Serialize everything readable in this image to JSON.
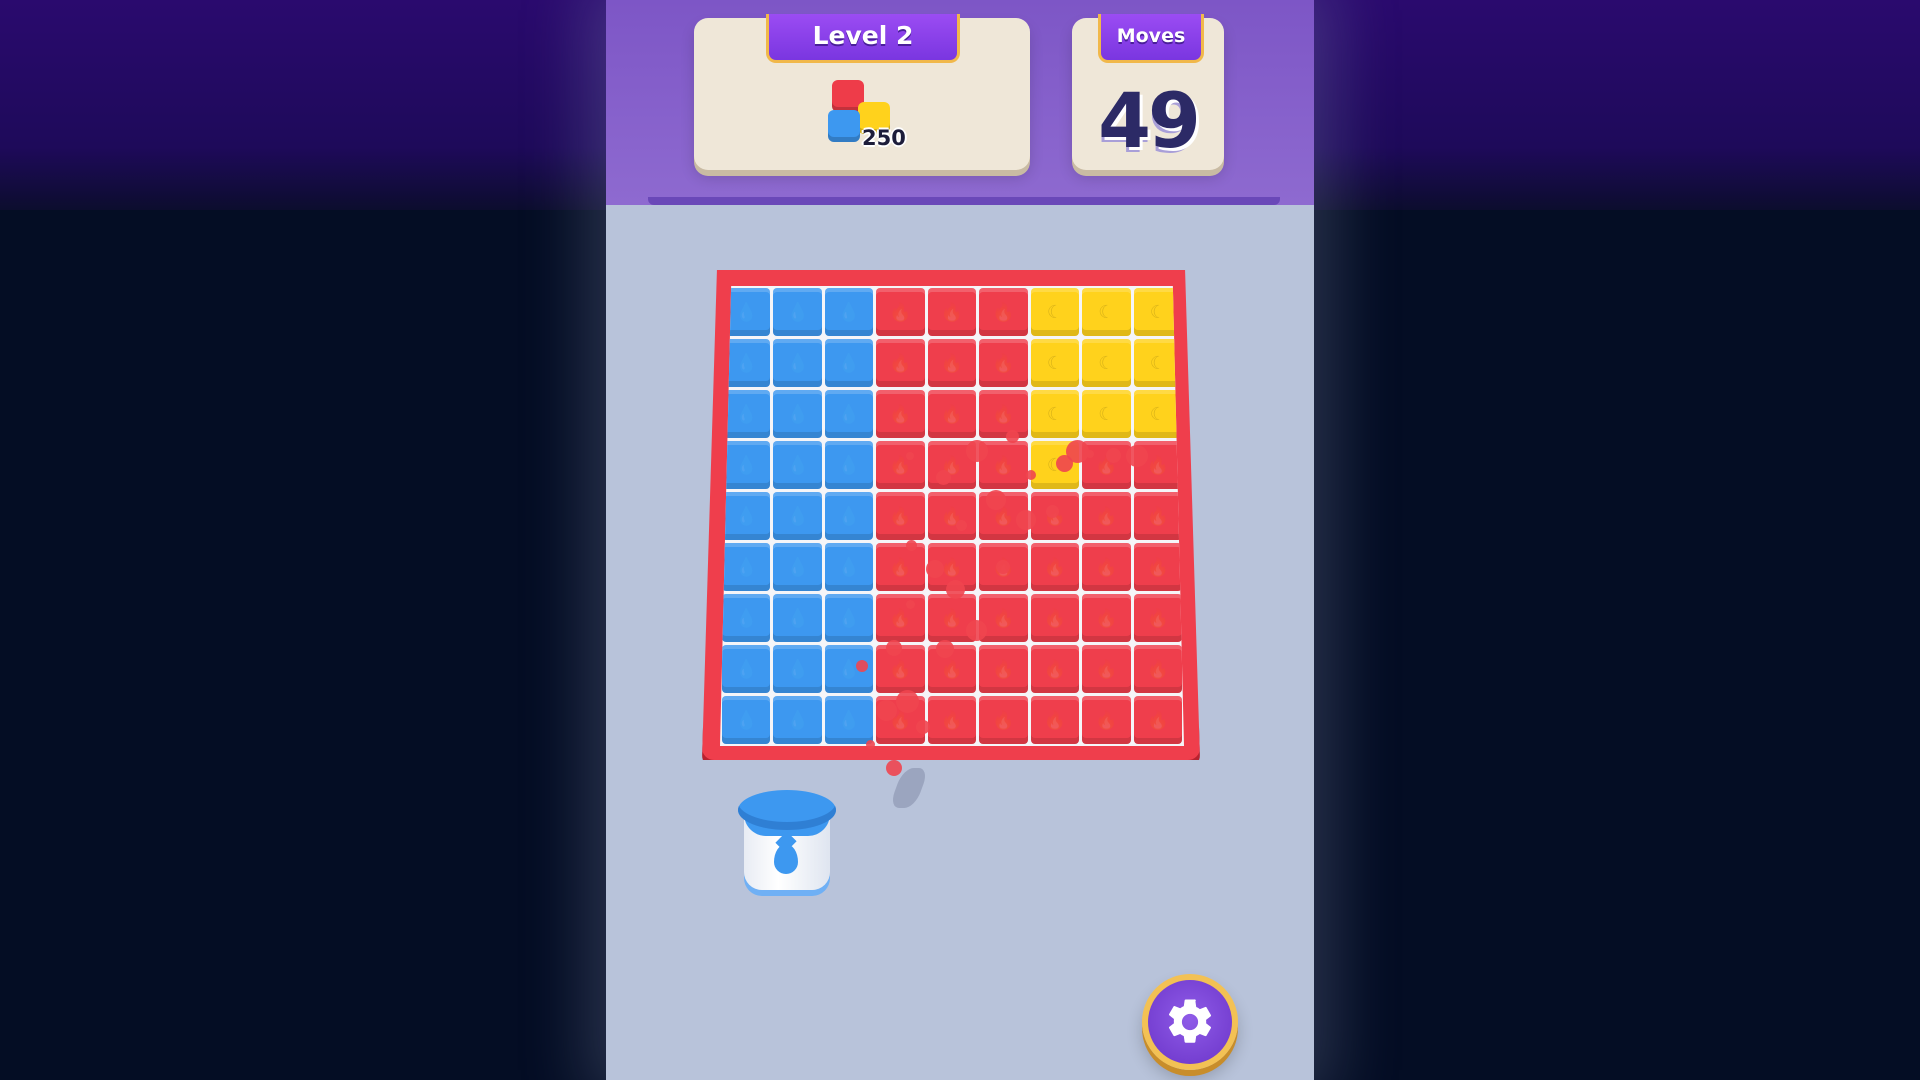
{
  "hud": {
    "level_label": "Level 2",
    "goal_count": "250",
    "moves_label": "Moves",
    "moves_value": "49"
  },
  "colors": {
    "blue": "#3d98f0",
    "red": "#ef3e4c",
    "yellow": "#ffd21c",
    "header_purple": "#8e6ad0",
    "board_frame": "#ef3e4c",
    "background": "#b8c3da"
  },
  "board": {
    "rows": 9,
    "cols": 9,
    "cells": [
      [
        "blue",
        "blue",
        "blue",
        "red",
        "red",
        "red",
        "yellow",
        "yellow",
        "yellow"
      ],
      [
        "blue",
        "blue",
        "blue",
        "red",
        "red",
        "red",
        "yellow",
        "yellow",
        "yellow"
      ],
      [
        "blue",
        "blue",
        "blue",
        "red",
        "red",
        "red",
        "yellow",
        "yellow",
        "yellow"
      ],
      [
        "blue",
        "blue",
        "blue",
        "red",
        "red",
        "red",
        "yellow",
        "red",
        "red"
      ],
      [
        "blue",
        "blue",
        "blue",
        "red",
        "red",
        "red",
        "red",
        "red",
        "red"
      ],
      [
        "blue",
        "blue",
        "blue",
        "red",
        "red",
        "red",
        "red",
        "red",
        "red"
      ],
      [
        "blue",
        "blue",
        "blue",
        "red",
        "red",
        "red",
        "red",
        "red",
        "red"
      ],
      [
        "blue",
        "blue",
        "blue",
        "red",
        "red",
        "red",
        "red",
        "red",
        "red"
      ],
      [
        "blue",
        "blue",
        "blue",
        "red",
        "red",
        "red",
        "red",
        "red",
        "red"
      ]
    ],
    "cell_icons": {
      "blue": "💧",
      "red": "🔥",
      "yellow": "☾"
    }
  },
  "tools": {
    "paint_bucket_color": "blue",
    "settings_icon": "gear-icon"
  }
}
